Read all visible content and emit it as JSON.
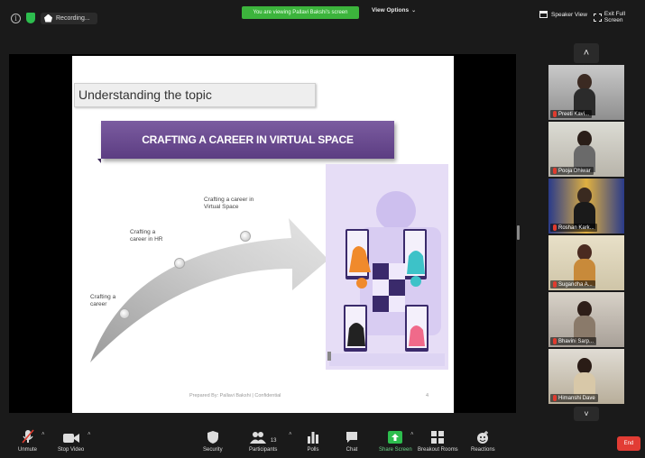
{
  "topbar": {
    "recording_label": "Recording...",
    "viewing_banner": "You are viewing Pallavi Bakshi's screen",
    "view_options_label": "View Options",
    "speaker_view_label": "Speaker View",
    "exit_fullscreen_label": "Exit Full Screen"
  },
  "slide": {
    "title": "Understanding the topic",
    "banner": "CRAFTING A CAREER IN VIRTUAL SPACE",
    "step1": "Crafting a career",
    "step2": "Crafting a career in HR",
    "step3": "Crafting a career in Virtual Space",
    "footer": "Prepared By: Pallavi Bakshi | Confidential",
    "page": "4",
    "colors": {
      "banner": "#6b4c90",
      "illustration_bg": "#e6ddf6"
    }
  },
  "participants": [
    {
      "name": "Preeti Kavi..."
    },
    {
      "name": "Pooja Dhiwar"
    },
    {
      "name": "Roshan Kark..."
    },
    {
      "name": "Sugandha A..."
    },
    {
      "name": "Bhavini Sarp..."
    },
    {
      "name": "Himanshi Dave"
    }
  ],
  "toolbar": {
    "unmute": "Unmute",
    "stop_video": "Stop Video",
    "security": "Security",
    "participants": "Participants",
    "participants_count": "13",
    "polls": "Polls",
    "chat": "Chat",
    "share_screen": "Share Screen",
    "breakout_rooms": "Breakout Rooms",
    "reactions": "Reactions",
    "end": "End"
  },
  "icons": [
    "info-icon",
    "shield-icon",
    "recording-icon",
    "speaker-view-icon",
    "exit-fullscreen-icon",
    "chevron-up-icon",
    "chevron-down-icon",
    "mic-muted-icon",
    "video-icon",
    "security-icon",
    "participants-icon",
    "polls-icon",
    "chat-icon",
    "share-screen-icon",
    "breakout-icon",
    "reactions-icon"
  ]
}
